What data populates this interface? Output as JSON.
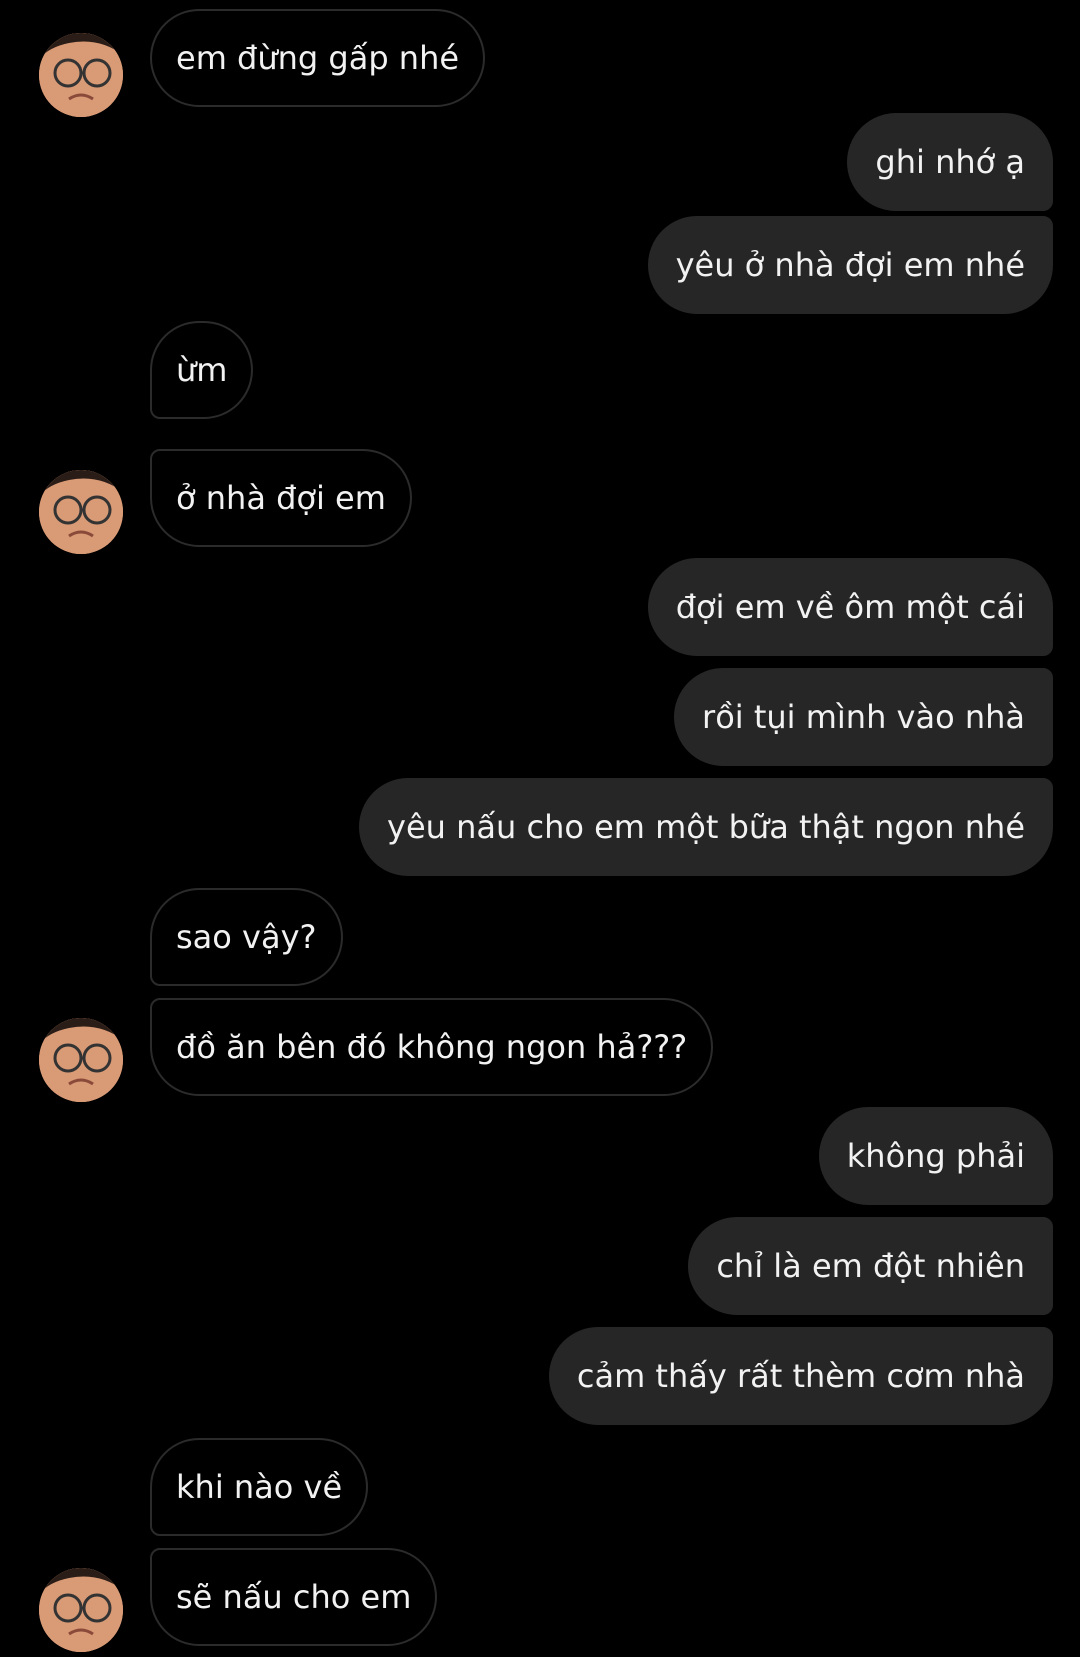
{
  "conversation": {
    "messages": [
      {
        "sender": "contact",
        "text": "em đừng gấp nhé"
      },
      {
        "sender": "me",
        "text": "ghi nhớ ạ"
      },
      {
        "sender": "me",
        "text": "yêu ở nhà đợi em nhé"
      },
      {
        "sender": "contact",
        "text": "ừm"
      },
      {
        "sender": "contact",
        "text": "ở nhà đợi em"
      },
      {
        "sender": "me",
        "text": "đợi em về ôm một cái"
      },
      {
        "sender": "me",
        "text": "rồi tụi mình vào nhà"
      },
      {
        "sender": "me",
        "text": "yêu nấu cho em một bữa thật ngon nhé"
      },
      {
        "sender": "contact",
        "text": "sao vậy?"
      },
      {
        "sender": "contact",
        "text": "đồ ăn bên đó không ngon hả???"
      },
      {
        "sender": "me",
        "text": "không phải"
      },
      {
        "sender": "me",
        "text": "chỉ là em đột nhiên"
      },
      {
        "sender": "me",
        "text": "cảm thấy rất thèm cơm nhà"
      },
      {
        "sender": "contact",
        "text": "khi nào về"
      },
      {
        "sender": "contact",
        "text": "sẽ nấu cho em"
      }
    ]
  },
  "colors": {
    "background": "#000000",
    "incoming_bubble_border": "#2b2b2b",
    "outgoing_bubble": "#262626",
    "text": "#f2f2f2"
  },
  "icons": {
    "contact_avatar": "avatar-face"
  }
}
